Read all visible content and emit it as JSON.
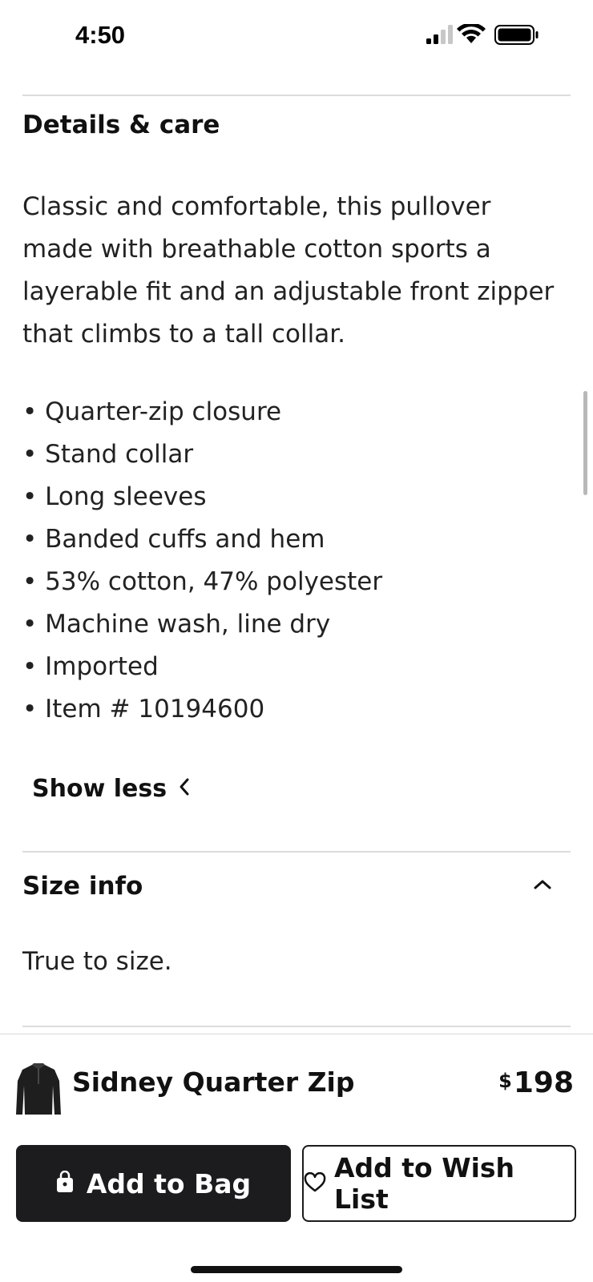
{
  "status_bar": {
    "time": "4:50",
    "icons": [
      "cellular-signal-icon",
      "wifi-icon",
      "battery-icon"
    ]
  },
  "details": {
    "title": "Details & care",
    "description": "Classic and comfortable, this pullover made with breathable cotton sports a layerable fit and an adjustable front zipper that climbs to a tall collar.",
    "bullets": [
      "• Quarter-zip closure",
      "• Stand collar",
      "• Long sleeves",
      "• Banded cuffs and hem",
      "• 53% cotton, 47% polyester",
      "• Machine wash, line dry",
      "• Imported",
      "• Item # 10194600"
    ],
    "toggle_label": "Show less"
  },
  "size_info": {
    "title": "Size info",
    "text": "True to size."
  },
  "purchase_bar": {
    "product_name": "Sidney Quarter Zip",
    "price_currency": "$",
    "price_amount": "198",
    "add_to_bag_label": "Add to Bag",
    "wish_list_label": "Add to Wish List"
  },
  "colors": {
    "primary_dark": "#1c1c1e",
    "divider": "#dcdcdc",
    "background": "#ffffff"
  }
}
